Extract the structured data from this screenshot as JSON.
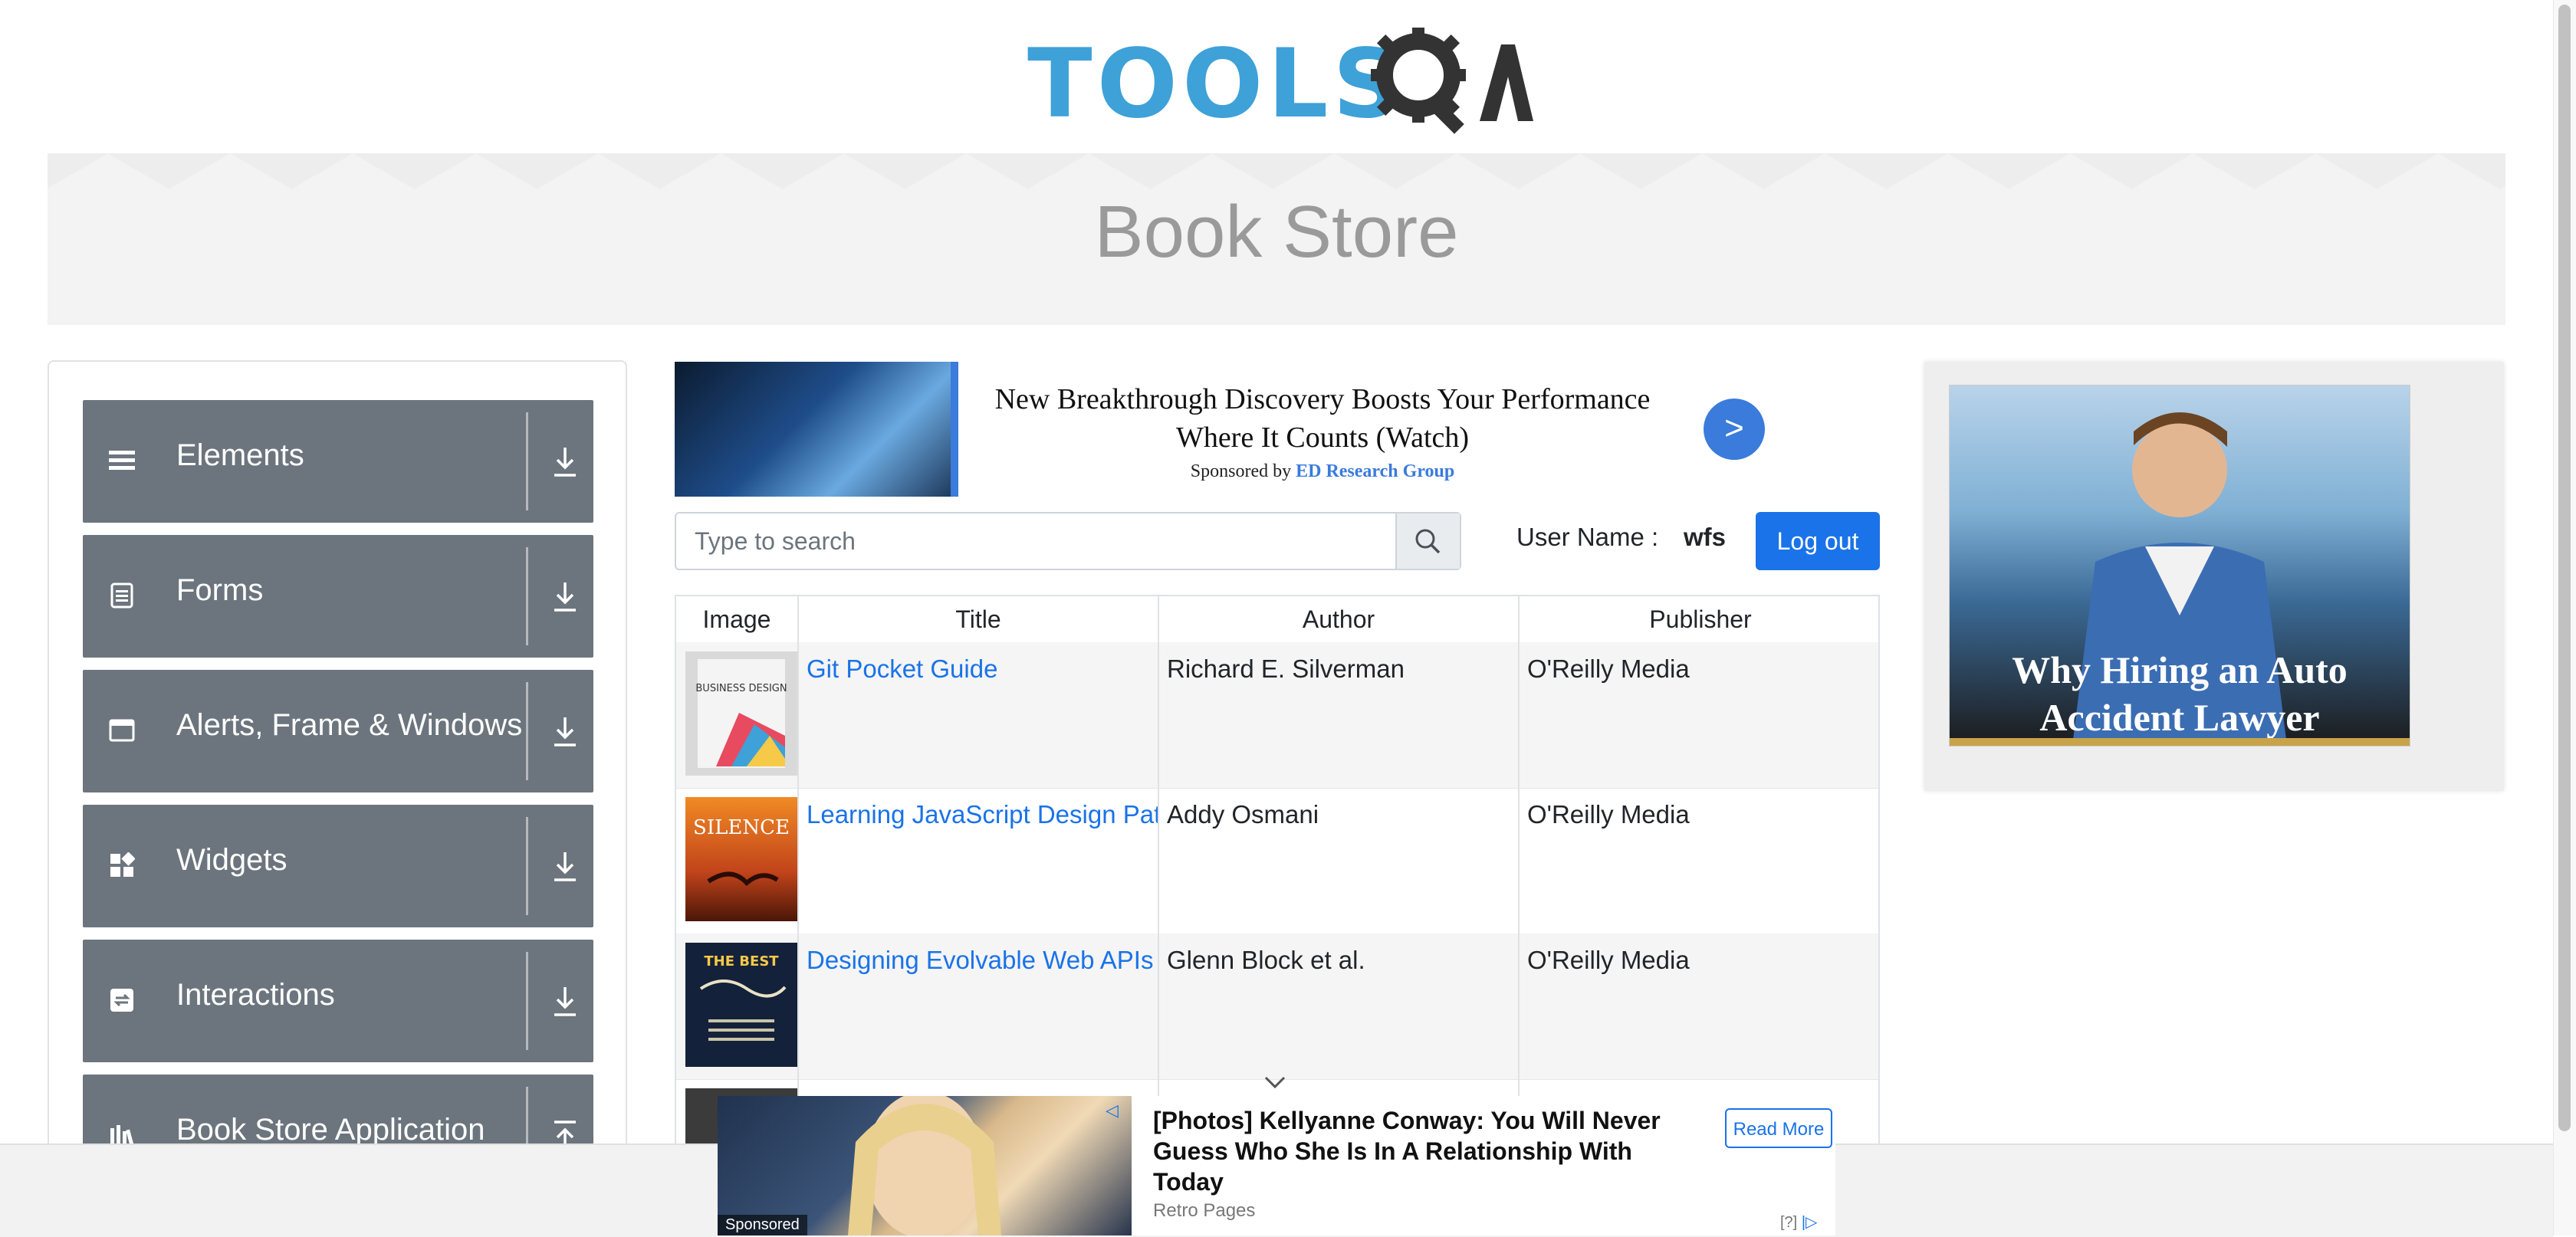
{
  "header": {
    "logo_text": "TOOLS",
    "logo_qa": "QA",
    "banner_title": "Book Store"
  },
  "sidebar": {
    "groups": [
      {
        "label": "Elements",
        "icon": "hamburger-icon"
      },
      {
        "label": "Forms",
        "icon": "document-icon"
      },
      {
        "label": "Alerts, Frame & Windows",
        "icon": "window-icon"
      },
      {
        "label": "Widgets",
        "icon": "widgets-icon"
      },
      {
        "label": "Interactions",
        "icon": "interactions-icon"
      },
      {
        "label": "Book Store Application",
        "icon": "bookstore-icon"
      }
    ]
  },
  "ad_top": {
    "headline": "New Breakthrough Discovery Boosts Your Performance Where It Counts (Watch)",
    "sponsor_prefix": "Sponsored by",
    "sponsor_name": "ED Research Group",
    "go_label": ">"
  },
  "search": {
    "placeholder": "Type to search"
  },
  "user": {
    "label": "User Name :",
    "name": "wfs",
    "logout_label": "Log out"
  },
  "table": {
    "headers": [
      "Image",
      "Title",
      "Author",
      "Publisher"
    ],
    "rows": [
      {
        "title": "Git Pocket Guide",
        "author": "Richard E. Silverman",
        "publisher": "O'Reilly Media",
        "cover_text": "BUSINESS DESIGN"
      },
      {
        "title": "Learning JavaScript Design Patterns",
        "author": "Addy Osmani",
        "publisher": "O'Reilly Media",
        "cover_text": "SILENCE"
      },
      {
        "title": "Designing Evolvable Web APIs with ASP.NET",
        "author": "Glenn Block et al.",
        "publisher": "O'Reilly Media",
        "cover_text": "THE BEST"
      }
    ]
  },
  "ad_right": {
    "text": "Why Hiring an Auto Accident Lawyer"
  },
  "ad_bottom": {
    "sponsored": "Sponsored",
    "headline": "[Photos] Kellyanne Conway: You Will Never Guess Who She Is In A Relationship With Today",
    "source": "Retro Pages",
    "read_more": "Read More",
    "help": "[?]"
  }
}
